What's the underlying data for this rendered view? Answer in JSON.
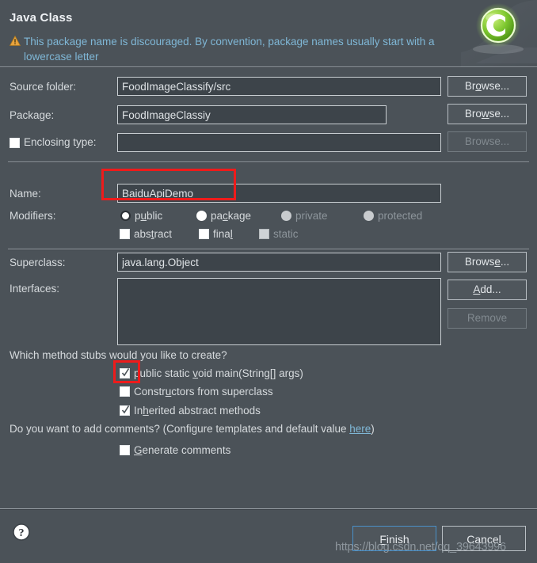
{
  "header": {
    "title": "Java Class",
    "warning_text": "This package name is discouraged. By convention, package names usually start with a lowercase letter",
    "warning_icon": "warning-triangle-icon",
    "banner_icon": "java-class-green-c-icon"
  },
  "fields": {
    "source_folder": {
      "label": "Source folder:",
      "value": "FoodImageClassify/src",
      "button": {
        "pre": "Br",
        "mnemonic": "o",
        "post": "wse..."
      }
    },
    "package": {
      "label": "Package:",
      "value": "FoodImageClassiy",
      "button": {
        "pre": "Bro",
        "mnemonic": "w",
        "post": "se..."
      }
    },
    "enclosing_type": {
      "label": "Enclosing type:",
      "checked": false,
      "value": "",
      "button": {
        "pre": "Br",
        "mnemonic": "o",
        "post": "wse..."
      },
      "button_disabled": true
    },
    "name": {
      "label": "Name:",
      "value": "BaiduApiDemo"
    },
    "superclass": {
      "label": "Superclass:",
      "value": "java.lang.Object",
      "button": {
        "pre": "Brows",
        "mnemonic": "e",
        "post": "..."
      }
    },
    "interfaces": {
      "label": "Interfaces:",
      "items": [],
      "add_button": {
        "pre": "",
        "mnemonic": "A",
        "post": "dd..."
      },
      "remove_button": "Remove",
      "remove_disabled": true
    }
  },
  "modifiers": {
    "label": "Modifiers:",
    "access": [
      {
        "label_pre": "p",
        "mnemonic": "u",
        "label_post": "blic",
        "selected": true,
        "disabled": false,
        "name": "public"
      },
      {
        "label_pre": "pa",
        "mnemonic": "c",
        "label_post": "kage",
        "selected": false,
        "disabled": false,
        "name": "package"
      },
      {
        "label_pre": "private",
        "mnemonic": "",
        "label_post": "",
        "selected": false,
        "disabled": true,
        "name": "private"
      },
      {
        "label_pre": "protected",
        "mnemonic": "",
        "label_post": "",
        "selected": false,
        "disabled": true,
        "name": "protected"
      }
    ],
    "flags": [
      {
        "label_pre": "abs",
        "mnemonic": "t",
        "label_post": "ract",
        "checked": false,
        "disabled": false,
        "name": "abstract"
      },
      {
        "label_pre": "fina",
        "mnemonic": "l",
        "label_post": "",
        "checked": false,
        "disabled": false,
        "name": "final"
      },
      {
        "label_pre": "static",
        "mnemonic": "",
        "label_post": "",
        "checked": false,
        "disabled": true,
        "name": "static"
      }
    ]
  },
  "stubs": {
    "question": "Which method stubs would you like to create?",
    "options": [
      {
        "pre": "public static ",
        "mnemonic": "v",
        "post": "oid main(String[] args)",
        "checked": true,
        "name": "main-method"
      },
      {
        "pre": "Constr",
        "mnemonic": "u",
        "post": "ctors from superclass",
        "checked": false,
        "name": "constructors-from-superclass"
      },
      {
        "pre": "In",
        "mnemonic": "h",
        "post": "erited abstract methods",
        "checked": true,
        "name": "inherited-abstract-methods"
      }
    ]
  },
  "comments": {
    "question_pre": "Do you want to add comments? (Configure templates and default value ",
    "link": "here",
    "question_post": ")",
    "generate": {
      "pre": "",
      "mnemonic": "G",
      "post": "enerate comments",
      "checked": false
    }
  },
  "footer": {
    "help_icon": "help-question-icon",
    "finish": {
      "pre": "",
      "mnemonic": "F",
      "post": "inish"
    },
    "cancel": {
      "pre": "Cance",
      "mnemonic": "l",
      "post": ""
    }
  },
  "watermark": "https://blog.csdn.net/qq_39643996",
  "colors": {
    "background": "#4b5258",
    "field_background": "#3d444a",
    "text": "#d6dadd",
    "link": "#7fb7d6",
    "annotation": "#ee1b1b",
    "focus_border": "#4a90c8"
  }
}
